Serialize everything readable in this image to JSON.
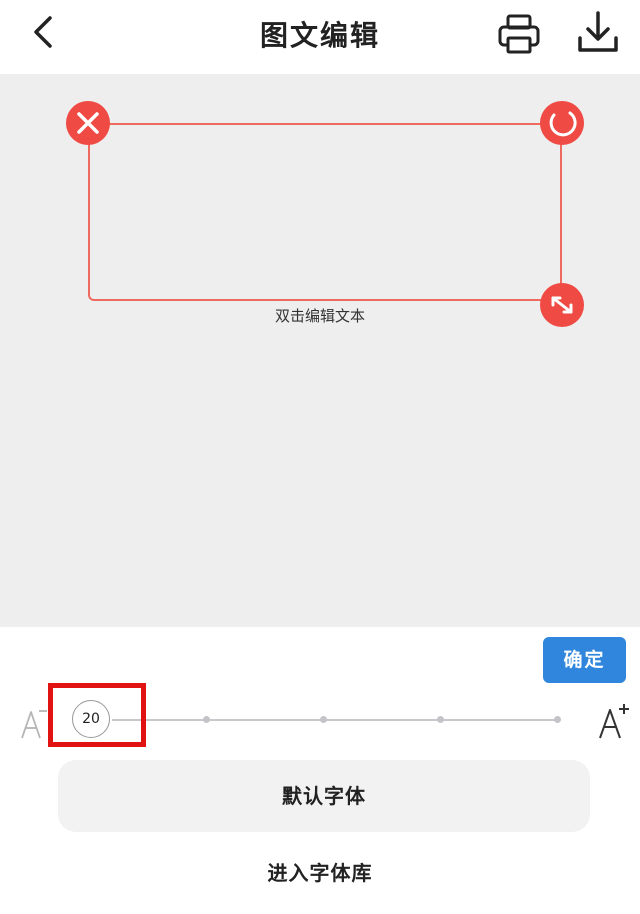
{
  "header": {
    "title": "图文编辑",
    "icons": {
      "back": "chevron-left-icon",
      "print": "printer-icon",
      "download": "download-icon"
    }
  },
  "canvas": {
    "placeholder_text": "双击编辑文本",
    "handles": {
      "delete": "close-icon",
      "rotate": "rotate-icon",
      "resize": "resize-icon"
    },
    "accent_color": "#ef4b44"
  },
  "toolbar": {
    "confirm_label": "确定",
    "confirm_color": "#2f86dc"
  },
  "font_size": {
    "value": "20",
    "decrease_icon": "font-decrease-icon",
    "increase_icon": "font-increase-icon"
  },
  "actions": {
    "default_font_label": "默认字体",
    "font_library_label": "进入字体库"
  }
}
